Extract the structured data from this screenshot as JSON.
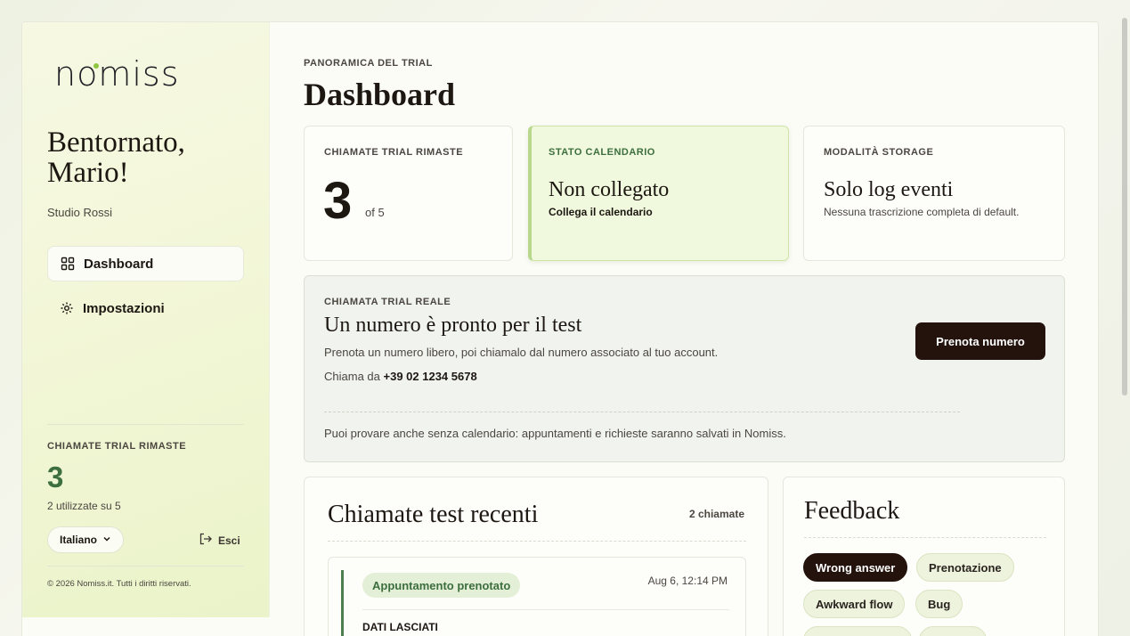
{
  "app": {
    "logo": "nomiss",
    "welcome": "Bentornato, Mario!",
    "studio": "Studio Rossi"
  },
  "sidebar": {
    "items": [
      {
        "label": "Dashboard",
        "icon": "grid-icon",
        "active": true
      },
      {
        "label": "Impostazioni",
        "icon": "gear-icon",
        "active": false
      }
    ],
    "trial_label": "CHIAMATE TRIAL RIMASTE",
    "trial_count": "3",
    "trial_used": "2 utilizzate su 5",
    "language": "Italiano",
    "logout": "Esci",
    "copyright": "© 2026 Nomiss.it. Tutti i diritti riservati."
  },
  "header": {
    "eyebrow": "PANORAMICA DEL TRIAL",
    "title": "Dashboard"
  },
  "stats": [
    {
      "label": "CHIAMATE TRIAL RIMASTE",
      "value": "3",
      "suffix": "of 5"
    },
    {
      "label": "STATO CALENDARIO",
      "title": "Non collegato",
      "sub": "Collega il calendario"
    },
    {
      "label": "MODALITÀ STORAGE",
      "title": "Solo log eventi",
      "sub": "Nessuna trascrizione completa di default."
    }
  ],
  "trial_call": {
    "eyebrow": "CHIAMATA TRIAL REALE",
    "title": "Un numero è pronto per il test",
    "description": "Prenota un numero libero, poi chiamalo dal numero associato al tuo account.",
    "call_from_label": "Chiama da",
    "call_from_number": "+39 02 1234 5678",
    "button": "Prenota numero",
    "note": "Puoi provare anche senza calendario: appuntamenti e richieste saranno salvati in Nomiss."
  },
  "recent": {
    "title": "Chiamate test recenti",
    "count": "2 chiamate",
    "items": [
      {
        "badge": "Appuntamento prenotato",
        "time": "Aug 6, 12:14 PM",
        "section": "DATI LASCIATI"
      }
    ]
  },
  "feedback": {
    "title": "Feedback",
    "chips": [
      "Wrong answer",
      "Prenotazione",
      "Awkward flow",
      "Bug"
    ]
  },
  "colors": {
    "accent": "#3c6e3e",
    "dark_button": "#23130c",
    "highlight_card": "#f0f9dd",
    "logo_dot": "#8ec63f"
  }
}
